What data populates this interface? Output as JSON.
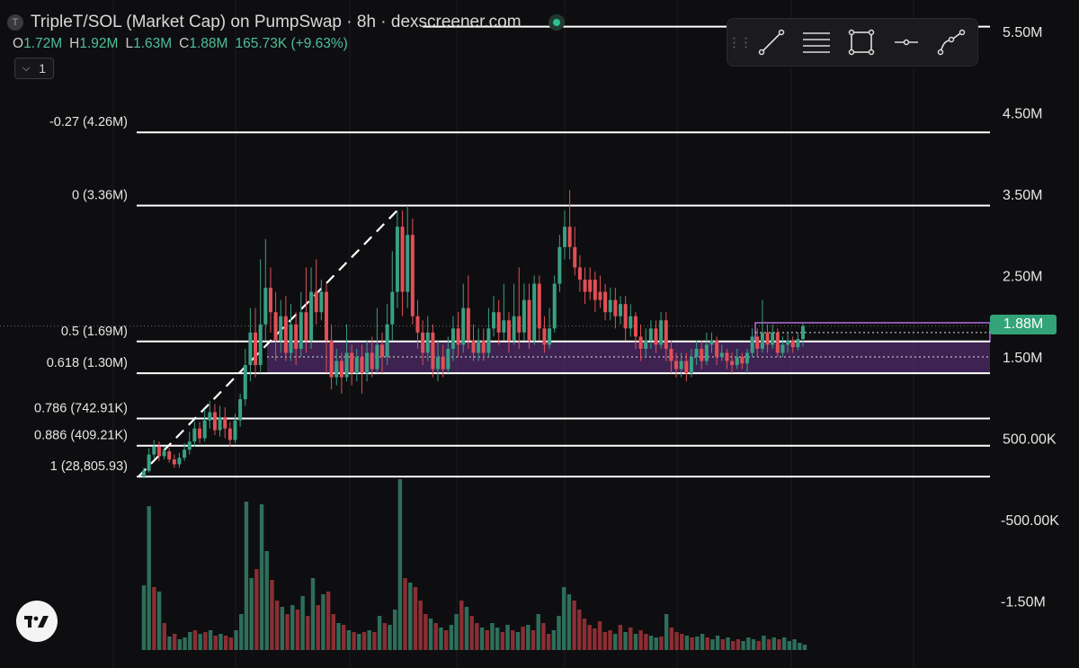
{
  "header": {
    "symbol_icon": "T",
    "title": "TripleT/SOL (Market Cap) on PumpSwap · 8h · dexscreener.com",
    "ohlc": [
      {
        "k": "O",
        "v": "1.72M"
      },
      {
        "k": "H",
        "v": "1.92M"
      },
      {
        "k": "L",
        "v": "1.63M"
      },
      {
        "k": "C",
        "v": "1.88M"
      },
      {
        "k": "",
        "v": "165.73K (+9.63%)"
      }
    ],
    "collapse_count": "1"
  },
  "toolbar": {
    "tools": [
      "trend-line-icon",
      "fib-lines-icon",
      "rectangle-icon",
      "horizontal-line-icon",
      "path-icon"
    ]
  },
  "price_tag": "1.88M",
  "logo": "TV",
  "colors": {
    "background": "#0e0e10",
    "up": "#3a9f83",
    "down": "#e14f56",
    "up_volume": "#2e6e5b",
    "down_volume": "#8b2e33",
    "fib": "#ffffff",
    "zone": "#7a3fa3",
    "zone_border": "#b46ae0",
    "label": "#e6e6e6"
  },
  "chart_data": {
    "type": "candlestick",
    "timeframe": "8h",
    "yaxis_ticks": [
      "5.50M",
      "4.50M",
      "3.50M",
      "2.50M",
      "1.50M",
      "500.00K",
      "-500.00K",
      "-1.50M"
    ],
    "fib_levels": [
      {
        "label": "-0.27 (4.26M)",
        "value": 4260000
      },
      {
        "label": "0 (3.36M)",
        "value": 3360000
      },
      {
        "label": "0.5 (1.69M)",
        "value": 1690000
      },
      {
        "label": "0.618 (1.30M)",
        "value": 1300000
      },
      {
        "label": "0.786 (742.91K)",
        "value": 742910
      },
      {
        "label": "0.886 (409.21K)",
        "value": 409210
      },
      {
        "label": "1 (28,805.93)",
        "value": 28805.93
      }
    ],
    "fib_extra_line": 5560000,
    "zone": {
      "from": 1300000,
      "to": 1690000
    },
    "zone_upper": {
      "from": 1690000,
      "to": 1920000
    },
    "last_close": 1880000,
    "trend": {
      "from": 28805.93,
      "to": 3360000
    },
    "volume_zero": -1540000,
    "candles_from_high": [
      [
        "up",
        1.15,
        0.95
      ],
      [
        "up",
        1.3,
        1.05
      ],
      [
        "down",
        1.45,
        1.2
      ],
      [
        "up",
        1.35,
        1.1
      ],
      [
        "up",
        1.5,
        1.2
      ],
      [
        "down",
        1.7,
        1.35
      ],
      [
        "up",
        1.55,
        1.25
      ],
      [
        "up",
        1.75,
        1.4
      ],
      [
        "up",
        1.95,
        1.55
      ],
      [
        "down",
        2.1,
        1.75
      ]
    ],
    "candles": [
      [
        "u",
        0.03,
        0.1,
        0.01,
        0.14
      ],
      [
        "u",
        0.1,
        0.3,
        0.08,
        0.38
      ],
      [
        "u",
        0.3,
        0.4,
        0.25,
        0.48
      ],
      [
        "d",
        0.4,
        0.28,
        0.22,
        0.46
      ],
      [
        "u",
        0.28,
        0.34,
        0.24,
        0.4
      ],
      [
        "d",
        0.34,
        0.24,
        0.2,
        0.38
      ],
      [
        "d",
        0.24,
        0.18,
        0.14,
        0.3
      ],
      [
        "u",
        0.18,
        0.26,
        0.14,
        0.32
      ],
      [
        "u",
        0.26,
        0.36,
        0.22,
        0.44
      ],
      [
        "u",
        0.36,
        0.46,
        0.3,
        0.58
      ],
      [
        "u",
        0.46,
        0.62,
        0.4,
        0.7
      ],
      [
        "d",
        0.62,
        0.5,
        0.44,
        0.7
      ],
      [
        "u",
        0.5,
        0.72,
        0.46,
        0.86
      ],
      [
        "u",
        0.72,
        0.82,
        0.62,
        0.96
      ],
      [
        "d",
        0.82,
        0.6,
        0.54,
        0.92
      ],
      [
        "u",
        0.6,
        0.76,
        0.52,
        0.9
      ],
      [
        "d",
        0.76,
        0.62,
        0.5,
        0.88
      ],
      [
        "d",
        0.62,
        0.48,
        0.4,
        0.7
      ],
      [
        "u",
        0.48,
        0.72,
        0.44,
        0.8
      ],
      [
        "u",
        0.72,
        0.98,
        0.64,
        1.05
      ],
      [
        "u",
        0.98,
        1.4,
        0.9,
        1.6
      ],
      [
        "u",
        1.4,
        1.8,
        1.2,
        2.1
      ],
      [
        "d",
        1.8,
        1.4,
        1.25,
        2.1
      ],
      [
        "u",
        1.4,
        1.9,
        1.3,
        2.7
      ],
      [
        "u",
        1.9,
        2.35,
        1.7,
        2.95
      ],
      [
        "d",
        2.35,
        2.05,
        1.8,
        2.6
      ],
      [
        "d",
        2.05,
        1.7,
        1.45,
        2.3
      ],
      [
        "u",
        1.7,
        2.0,
        1.55,
        2.2
      ],
      [
        "d",
        2.0,
        1.55,
        1.45,
        2.25
      ],
      [
        "u",
        1.55,
        1.9,
        1.45,
        2.15
      ],
      [
        "d",
        1.9,
        1.6,
        1.4,
        2.05
      ],
      [
        "u",
        1.6,
        2.05,
        1.5,
        2.3
      ],
      [
        "d",
        2.05,
        1.7,
        1.55,
        2.6
      ],
      [
        "u",
        1.7,
        2.3,
        1.6,
        2.6
      ],
      [
        "d",
        2.3,
        2.05,
        1.9,
        2.7
      ],
      [
        "u",
        2.05,
        2.3,
        1.95,
        2.45
      ],
      [
        "d",
        2.3,
        1.7,
        1.3,
        2.4
      ],
      [
        "d",
        1.7,
        1.25,
        1.1,
        1.9
      ],
      [
        "u",
        1.25,
        1.45,
        1.15,
        1.6
      ],
      [
        "d",
        1.45,
        1.25,
        1.05,
        1.55
      ],
      [
        "u",
        1.25,
        1.55,
        1.2,
        1.9
      ],
      [
        "d",
        1.55,
        1.3,
        1.15,
        1.65
      ],
      [
        "u",
        1.3,
        1.5,
        1.2,
        1.6
      ],
      [
        "d",
        1.5,
        1.3,
        1.05,
        1.65
      ],
      [
        "u",
        1.3,
        1.55,
        1.2,
        1.7
      ],
      [
        "d",
        1.55,
        1.35,
        1.25,
        1.75
      ],
      [
        "u",
        1.35,
        1.65,
        1.3,
        2.1
      ],
      [
        "d",
        1.65,
        1.5,
        1.3,
        1.8
      ],
      [
        "u",
        1.5,
        1.9,
        1.4,
        2.15
      ],
      [
        "u",
        1.9,
        2.3,
        1.7,
        2.8
      ],
      [
        "u",
        2.3,
        3.1,
        2.1,
        3.3
      ],
      [
        "d",
        3.1,
        2.3,
        2.0,
        3.3
      ],
      [
        "u",
        2.3,
        3.0,
        2.1,
        3.36
      ],
      [
        "d",
        3.0,
        2.0,
        1.9,
        3.2
      ],
      [
        "d",
        2.0,
        1.8,
        1.6,
        2.2
      ],
      [
        "d",
        1.8,
        1.55,
        1.4,
        1.95
      ],
      [
        "u",
        1.55,
        1.8,
        1.45,
        2.0
      ],
      [
        "d",
        1.8,
        1.35,
        1.25,
        1.9
      ],
      [
        "u",
        1.35,
        1.5,
        1.2,
        1.7
      ],
      [
        "d",
        1.5,
        1.35,
        1.25,
        1.65
      ],
      [
        "u",
        1.35,
        1.6,
        1.3,
        1.75
      ],
      [
        "u",
        1.6,
        1.85,
        1.45,
        2.0
      ],
      [
        "d",
        1.85,
        1.65,
        1.5,
        2.05
      ],
      [
        "u",
        1.65,
        2.1,
        1.55,
        2.4
      ],
      [
        "d",
        2.1,
        1.7,
        1.6,
        2.5
      ],
      [
        "d",
        1.7,
        1.55,
        1.45,
        1.9
      ],
      [
        "u",
        1.55,
        1.7,
        1.45,
        1.85
      ],
      [
        "d",
        1.7,
        1.55,
        1.45,
        1.85
      ],
      [
        "u",
        1.55,
        1.85,
        1.5,
        2.1
      ],
      [
        "u",
        1.85,
        2.05,
        1.75,
        2.25
      ],
      [
        "d",
        2.05,
        1.8,
        1.65,
        2.2
      ],
      [
        "u",
        1.8,
        1.95,
        1.7,
        2.4
      ],
      [
        "d",
        1.95,
        1.7,
        1.55,
        2.05
      ],
      [
        "u",
        1.7,
        2.0,
        1.65,
        2.4
      ],
      [
        "d",
        2.0,
        1.8,
        1.6,
        2.6
      ],
      [
        "u",
        1.8,
        2.2,
        1.7,
        2.4
      ],
      [
        "d",
        2.2,
        1.7,
        1.6,
        2.4
      ],
      [
        "u",
        1.7,
        2.4,
        1.65,
        2.5
      ],
      [
        "d",
        2.4,
        1.85,
        1.7,
        2.5
      ],
      [
        "d",
        1.85,
        1.65,
        1.55,
        2.0
      ],
      [
        "u",
        1.65,
        1.85,
        1.6,
        2.1
      ],
      [
        "u",
        1.85,
        2.4,
        1.8,
        2.5
      ],
      [
        "u",
        2.4,
        2.85,
        2.3,
        3.0
      ],
      [
        "u",
        2.85,
        3.1,
        2.7,
        3.3
      ],
      [
        "d",
        3.1,
        2.85,
        2.7,
        3.55
      ],
      [
        "d",
        2.85,
        2.6,
        2.5,
        3.1
      ],
      [
        "d",
        2.6,
        2.45,
        2.3,
        2.75
      ],
      [
        "d",
        2.45,
        2.3,
        2.15,
        2.6
      ],
      [
        "d",
        2.3,
        2.45,
        2.2,
        2.6
      ],
      [
        "d",
        2.45,
        2.2,
        2.05,
        2.55
      ],
      [
        "d",
        2.2,
        2.3,
        2.1,
        2.5
      ],
      [
        "d",
        2.3,
        2.05,
        1.95,
        2.4
      ],
      [
        "u",
        2.05,
        2.2,
        1.95,
        2.35
      ],
      [
        "d",
        2.2,
        2.0,
        1.85,
        2.35
      ],
      [
        "u",
        2.0,
        2.15,
        1.9,
        2.25
      ],
      [
        "d",
        2.15,
        1.85,
        1.7,
        2.25
      ],
      [
        "u",
        1.85,
        2.0,
        1.75,
        2.15
      ],
      [
        "d",
        2.0,
        1.75,
        1.6,
        2.05
      ],
      [
        "d",
        1.75,
        1.6,
        1.45,
        1.9
      ],
      [
        "u",
        1.6,
        1.7,
        1.5,
        1.85
      ],
      [
        "u",
        1.7,
        1.85,
        1.6,
        1.95
      ],
      [
        "d",
        1.85,
        1.65,
        1.55,
        1.95
      ],
      [
        "u",
        1.65,
        1.95,
        1.6,
        2.05
      ],
      [
        "d",
        1.95,
        1.6,
        1.45,
        2.05
      ],
      [
        "d",
        1.6,
        1.45,
        1.3,
        1.7
      ],
      [
        "d",
        1.45,
        1.35,
        1.25,
        1.55
      ],
      [
        "u",
        1.35,
        1.45,
        1.25,
        1.55
      ],
      [
        "d",
        1.45,
        1.3,
        1.2,
        1.55
      ],
      [
        "u",
        1.3,
        1.5,
        1.25,
        1.6
      ],
      [
        "u",
        1.5,
        1.6,
        1.4,
        1.7
      ],
      [
        "d",
        1.6,
        1.45,
        1.35,
        1.7
      ],
      [
        "u",
        1.45,
        1.65,
        1.4,
        1.8
      ],
      [
        "u",
        1.65,
        1.7,
        1.55,
        1.8
      ],
      [
        "d",
        1.7,
        1.5,
        1.4,
        1.75
      ],
      [
        "u",
        1.5,
        1.55,
        1.45,
        1.65
      ],
      [
        "d",
        1.55,
        1.45,
        1.35,
        1.6
      ],
      [
        "d",
        1.45,
        1.4,
        1.3,
        1.55
      ],
      [
        "u",
        1.4,
        1.5,
        1.35,
        1.6
      ],
      [
        "d",
        1.5,
        1.42,
        1.35,
        1.55
      ],
      [
        "u",
        1.42,
        1.55,
        1.3,
        1.6
      ],
      [
        "u",
        1.55,
        1.75,
        1.5,
        1.85
      ],
      [
        "d",
        1.75,
        1.6,
        1.5,
        1.85
      ],
      [
        "u",
        1.6,
        1.8,
        1.55,
        2.2
      ],
      [
        "d",
        1.8,
        1.65,
        1.55,
        1.9
      ],
      [
        "u",
        1.65,
        1.8,
        1.6,
        1.9
      ],
      [
        "d",
        1.8,
        1.55,
        1.5,
        1.85
      ],
      [
        "u",
        1.55,
        1.65,
        1.5,
        1.75
      ],
      [
        "u",
        1.65,
        1.7,
        1.55,
        1.8
      ],
      [
        "d",
        1.7,
        1.62,
        1.55,
        1.75
      ],
      [
        "u",
        1.62,
        1.72,
        1.58,
        1.8
      ],
      [
        "u",
        1.72,
        1.88,
        1.63,
        1.92
      ]
    ],
    "volume": [
      [
        "u",
        0.72
      ],
      [
        "u",
        1.6
      ],
      [
        "d",
        0.7
      ],
      [
        "u",
        0.65
      ],
      [
        "d",
        0.3
      ],
      [
        "u",
        0.15
      ],
      [
        "d",
        0.18
      ],
      [
        "u",
        0.12
      ],
      [
        "u",
        0.14
      ],
      [
        "u",
        0.2
      ],
      [
        "d",
        0.22
      ],
      [
        "u",
        0.18
      ],
      [
        "d",
        0.2
      ],
      [
        "u",
        0.22
      ],
      [
        "d",
        0.16
      ],
      [
        "u",
        0.18
      ],
      [
        "d",
        0.16
      ],
      [
        "d",
        0.14
      ],
      [
        "u",
        0.22
      ],
      [
        "u",
        0.4
      ],
      [
        "u",
        1.65
      ],
      [
        "u",
        0.8
      ],
      [
        "d",
        0.9
      ],
      [
        "u",
        1.62
      ],
      [
        "u",
        1.1
      ],
      [
        "d",
        0.78
      ],
      [
        "d",
        0.55
      ],
      [
        "u",
        0.48
      ],
      [
        "d",
        0.4
      ],
      [
        "u",
        0.5
      ],
      [
        "d",
        0.45
      ],
      [
        "u",
        0.6
      ],
      [
        "d",
        0.38
      ],
      [
        "u",
        0.8
      ],
      [
        "d",
        0.5
      ],
      [
        "u",
        0.62
      ],
      [
        "d",
        0.65
      ],
      [
        "d",
        0.4
      ],
      [
        "u",
        0.3
      ],
      [
        "d",
        0.28
      ],
      [
        "u",
        0.22
      ],
      [
        "d",
        0.2
      ],
      [
        "u",
        0.18
      ],
      [
        "d",
        0.2
      ],
      [
        "u",
        0.22
      ],
      [
        "d",
        0.2
      ],
      [
        "u",
        0.38
      ],
      [
        "d",
        0.3
      ],
      [
        "u",
        0.28
      ],
      [
        "u",
        0.45
      ],
      [
        "u",
        1.9
      ],
      [
        "d",
        0.8
      ],
      [
        "u",
        0.75
      ],
      [
        "d",
        0.7
      ],
      [
        "d",
        0.55
      ],
      [
        "d",
        0.4
      ],
      [
        "u",
        0.35
      ],
      [
        "d",
        0.3
      ],
      [
        "u",
        0.25
      ],
      [
        "d",
        0.22
      ],
      [
        "u",
        0.28
      ],
      [
        "u",
        0.4
      ],
      [
        "d",
        0.55
      ],
      [
        "u",
        0.48
      ],
      [
        "d",
        0.38
      ],
      [
        "d",
        0.3
      ],
      [
        "u",
        0.25
      ],
      [
        "d",
        0.22
      ],
      [
        "u",
        0.3
      ],
      [
        "u",
        0.25
      ],
      [
        "d",
        0.2
      ],
      [
        "u",
        0.28
      ],
      [
        "d",
        0.22
      ],
      [
        "u",
        0.2
      ],
      [
        "d",
        0.26
      ],
      [
        "u",
        0.28
      ],
      [
        "d",
        0.22
      ],
      [
        "u",
        0.4
      ],
      [
        "d",
        0.3
      ],
      [
        "d",
        0.18
      ],
      [
        "u",
        0.22
      ],
      [
        "u",
        0.38
      ],
      [
        "u",
        0.7
      ],
      [
        "u",
        0.62
      ],
      [
        "d",
        0.55
      ],
      [
        "d",
        0.45
      ],
      [
        "d",
        0.35
      ],
      [
        "d",
        0.28
      ],
      [
        "d",
        0.24
      ],
      [
        "d",
        0.32
      ],
      [
        "d",
        0.2
      ],
      [
        "d",
        0.22
      ],
      [
        "u",
        0.18
      ],
      [
        "d",
        0.28
      ],
      [
        "u",
        0.2
      ],
      [
        "d",
        0.25
      ],
      [
        "u",
        0.18
      ],
      [
        "d",
        0.22
      ],
      [
        "d",
        0.18
      ],
      [
        "u",
        0.16
      ],
      [
        "u",
        0.14
      ],
      [
        "d",
        0.15
      ],
      [
        "u",
        0.4
      ],
      [
        "d",
        0.25
      ],
      [
        "d",
        0.2
      ],
      [
        "d",
        0.18
      ],
      [
        "u",
        0.16
      ],
      [
        "d",
        0.14
      ],
      [
        "u",
        0.15
      ],
      [
        "u",
        0.18
      ],
      [
        "d",
        0.14
      ],
      [
        "u",
        0.12
      ],
      [
        "u",
        0.16
      ],
      [
        "d",
        0.12
      ],
      [
        "u",
        0.14
      ],
      [
        "d",
        0.1
      ],
      [
        "d",
        0.12
      ],
      [
        "u",
        0.1
      ],
      [
        "u",
        0.14
      ],
      [
        "u",
        0.12
      ],
      [
        "d",
        0.1
      ],
      [
        "u",
        0.16
      ],
      [
        "d",
        0.12
      ],
      [
        "u",
        0.14
      ],
      [
        "d",
        0.12
      ],
      [
        "u",
        0.14
      ],
      [
        "u",
        0.1
      ],
      [
        "u",
        0.12
      ],
      [
        "u",
        0.08
      ],
      [
        "u",
        0.06
      ]
    ]
  }
}
